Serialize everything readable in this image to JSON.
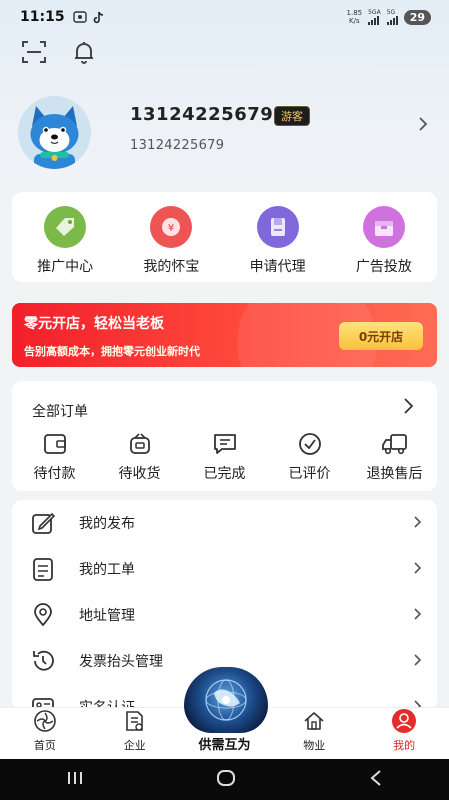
{
  "status_bar": {
    "time": "11:15",
    "speed_value": "1.85",
    "speed_unit": "K/s",
    "sim1": "5GA",
    "sim2": "5G",
    "battery": "29"
  },
  "profile": {
    "phone": "13124225679",
    "badge": "游客",
    "subtitle": "13124225679"
  },
  "shortcuts": [
    {
      "label": "推广中心",
      "icon": "tag-icon",
      "color": "#6fae3f"
    },
    {
      "label": "我的怀宝",
      "icon": "wallet-icon",
      "color": "#ef4e4e"
    },
    {
      "label": "申请代理",
      "icon": "document-icon",
      "color": "#7b63d8"
    },
    {
      "label": "广告投放",
      "icon": "ad-box-icon",
      "color": "#c868d6"
    }
  ],
  "banner": {
    "title": "零元开店，轻松当老板",
    "subtitle": "告别高额成本，拥抱零元创业新时代",
    "button": "0元开店"
  },
  "orders": {
    "title": "全部订单",
    "items": [
      {
        "label": "待付款",
        "icon": "wallet-icon"
      },
      {
        "label": "待收货",
        "icon": "package-icon"
      },
      {
        "label": "已完成",
        "icon": "message-icon"
      },
      {
        "label": "已评价",
        "icon": "check-circle-icon"
      },
      {
        "label": "退换售后",
        "icon": "truck-icon"
      }
    ]
  },
  "menu": [
    {
      "label": "我的发布",
      "icon": "edit-icon"
    },
    {
      "label": "我的工单",
      "icon": "clipboard-icon"
    },
    {
      "label": "地址管理",
      "icon": "location-icon"
    },
    {
      "label": "发票抬头管理",
      "icon": "history-icon"
    },
    {
      "label": "实名认证",
      "icon": "id-card-icon"
    }
  ],
  "tabbar": {
    "items": [
      {
        "label": "首页",
        "icon": "home-icon"
      },
      {
        "label": "企业",
        "icon": "enterprise-icon"
      },
      {
        "label": "供需互为",
        "icon": "globe-icon"
      },
      {
        "label": "物业",
        "icon": "property-icon"
      },
      {
        "label": "我的",
        "icon": "user-icon"
      }
    ],
    "active_color": "#e02424"
  }
}
